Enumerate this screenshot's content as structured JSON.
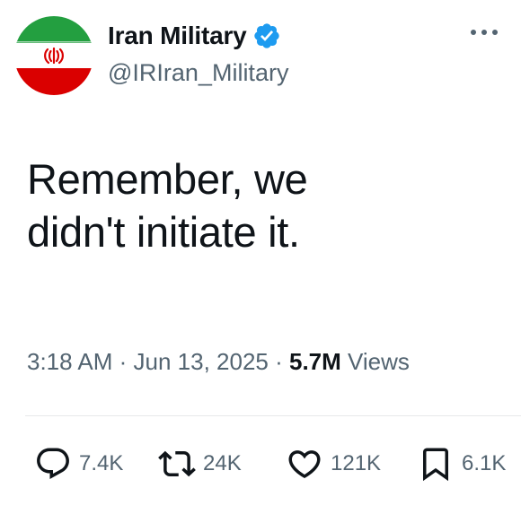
{
  "colors": {
    "verified_blue": "#1d9bf0",
    "text_primary": "#0f1419",
    "text_secondary": "#536471",
    "flag_green": "#239f40",
    "flag_white": "#ffffff",
    "flag_red": "#da0000"
  },
  "author": {
    "name": "Iran Military",
    "handle": "@IRIran_Military",
    "avatar_icon": "iran-flag-avatar",
    "verified_icon": "verified-badge-icon"
  },
  "tweet": {
    "text_line1": "Remember, we",
    "text_line2": "didn't initiate it."
  },
  "meta": {
    "time": "3:18 AM",
    "separator1": " · ",
    "date": "Jun 13, 2025",
    "separator2": " · ",
    "views_count": "5.7M",
    "views_label": " Views"
  },
  "actions": {
    "reply": {
      "icon": "reply-icon",
      "count": "7.4K"
    },
    "retweet": {
      "icon": "retweet-icon",
      "count": "24K"
    },
    "like": {
      "icon": "heart-icon",
      "count": "121K"
    },
    "bookmark": {
      "icon": "bookmark-icon",
      "count": "6.1K"
    }
  }
}
